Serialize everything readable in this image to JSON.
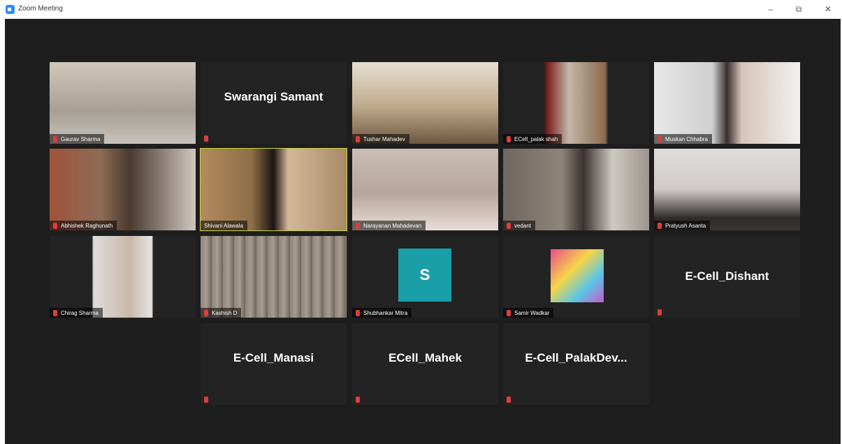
{
  "window": {
    "title": "Zoom Meeting",
    "minimize": "–",
    "maximize": "⧉",
    "close": "✕"
  },
  "participants": [
    {
      "name": "Gaurav Sharma",
      "type": "video",
      "bg": "#b7b0a4"
    },
    {
      "name": "Swarangi Samant",
      "type": "name"
    },
    {
      "name": "Tushar Mahadev",
      "type": "video",
      "bg": "#9b8a73"
    },
    {
      "name": "ECell_palak shah",
      "type": "video",
      "bg": "#7b2a2a"
    },
    {
      "name": "Muskan Chhabra",
      "type": "video",
      "bg": "#d8d8d8"
    },
    {
      "name": "Abhishek Raghunath",
      "type": "video",
      "bg": "#8b6b55"
    },
    {
      "name": "Shivani Alawala",
      "type": "video",
      "bg": "#a58a62",
      "active": true
    },
    {
      "name": "Narayanan Mahadevan",
      "type": "video",
      "bg": "#c2b6ae"
    },
    {
      "name": "vedant",
      "type": "video",
      "bg": "#857e75"
    },
    {
      "name": "Pratyush Asanta",
      "type": "video",
      "bg": "#d2d0ce"
    },
    {
      "name": "Chirag Sharma",
      "type": "video",
      "bg": "#d6d6d6"
    },
    {
      "name": "Kashish D",
      "type": "video",
      "bg": "#8b7f75"
    },
    {
      "name": "Shubhankar Mitra",
      "type": "avatar",
      "initial": "S"
    },
    {
      "name": "Samir Wadkar",
      "type": "image"
    },
    {
      "name": "E-Cell_Dishant",
      "type": "name"
    },
    {
      "name": "E-Cell_Manasi",
      "type": "name"
    },
    {
      "name": "ECell_Mahek",
      "type": "name"
    },
    {
      "name": "E-Cell_PalakDev...",
      "type": "name"
    }
  ]
}
